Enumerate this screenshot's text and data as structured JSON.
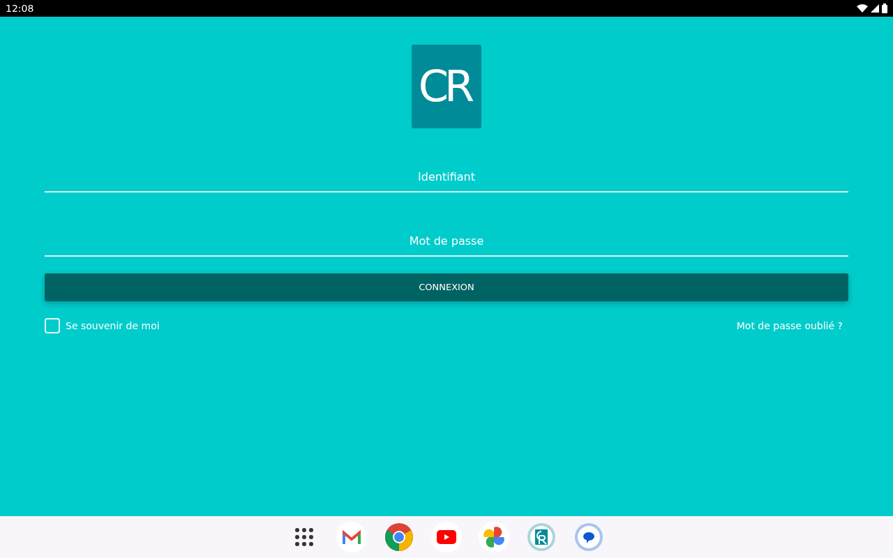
{
  "status_bar": {
    "time": "12:08"
  },
  "logo": {
    "text": "CR"
  },
  "fields": [
    {
      "placeholder": "Identifiant"
    },
    {
      "placeholder": "Mot de passe"
    }
  ],
  "login_button": {
    "label": "CONNEXION"
  },
  "remember_me": {
    "label": "Se souvenir de moi",
    "checked": false
  },
  "forgot_link": {
    "label": "Mot de passe oublié ?"
  },
  "dock": [
    {
      "kind": "apps"
    },
    {
      "kind": "mail"
    },
    {
      "kind": "browser"
    },
    {
      "kind": "video"
    },
    {
      "kind": "photos"
    },
    {
      "kind": "cr"
    },
    {
      "kind": "messages"
    }
  ]
}
